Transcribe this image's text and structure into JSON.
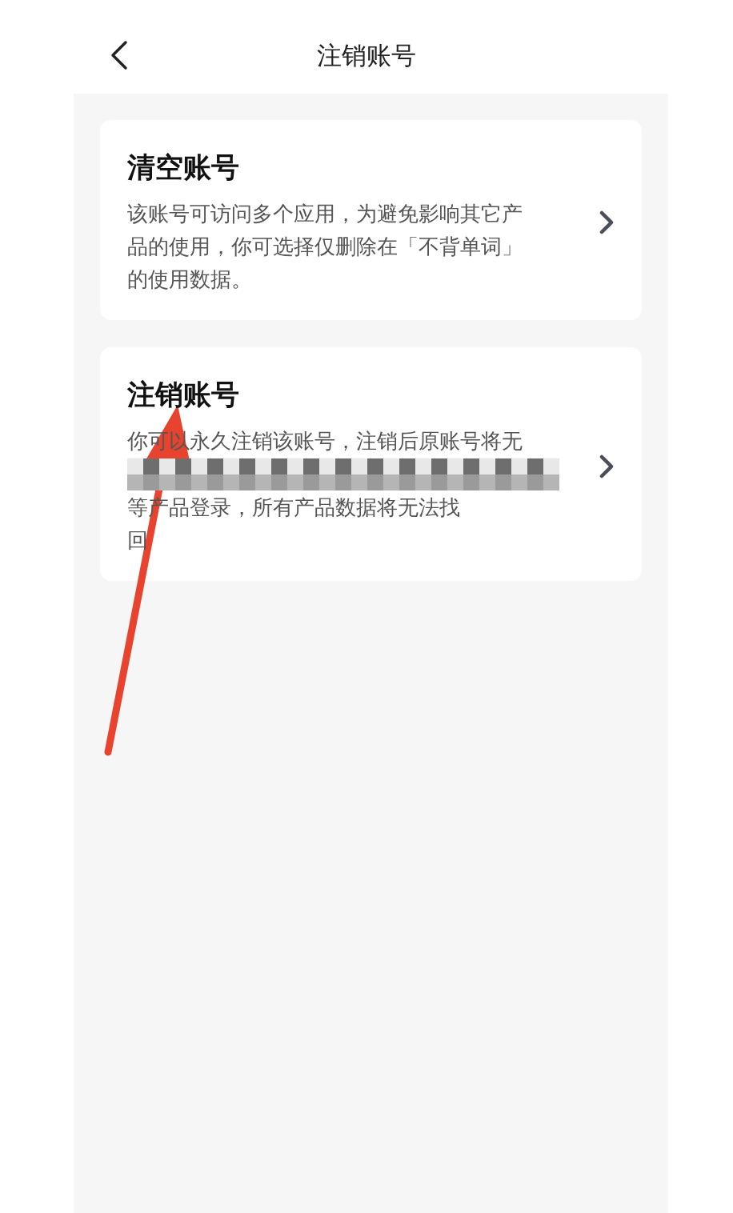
{
  "header": {
    "title": "注销账号"
  },
  "cards": [
    {
      "title": "清空账号",
      "lines": [
        {
          "kind": "text",
          "text": "该账号可访问多个应用，为避免影响其它产"
        },
        {
          "kind": "text",
          "text": "品的使用，你可选择仅删除在「不背单词」"
        },
        {
          "kind": "text",
          "text": "的使用数据。"
        }
      ]
    },
    {
      "title": "注销账号",
      "lines": [
        {
          "kind": "text",
          "text": "你可以永久注销该账号，注销后原账号将无"
        },
        {
          "kind": "redacted"
        },
        {
          "kind": "text",
          "text": "等产品登录，所有产品数据将无法找"
        },
        {
          "kind": "text",
          "text": "回"
        }
      ]
    }
  ],
  "annotation": {
    "kind": "arrow"
  }
}
